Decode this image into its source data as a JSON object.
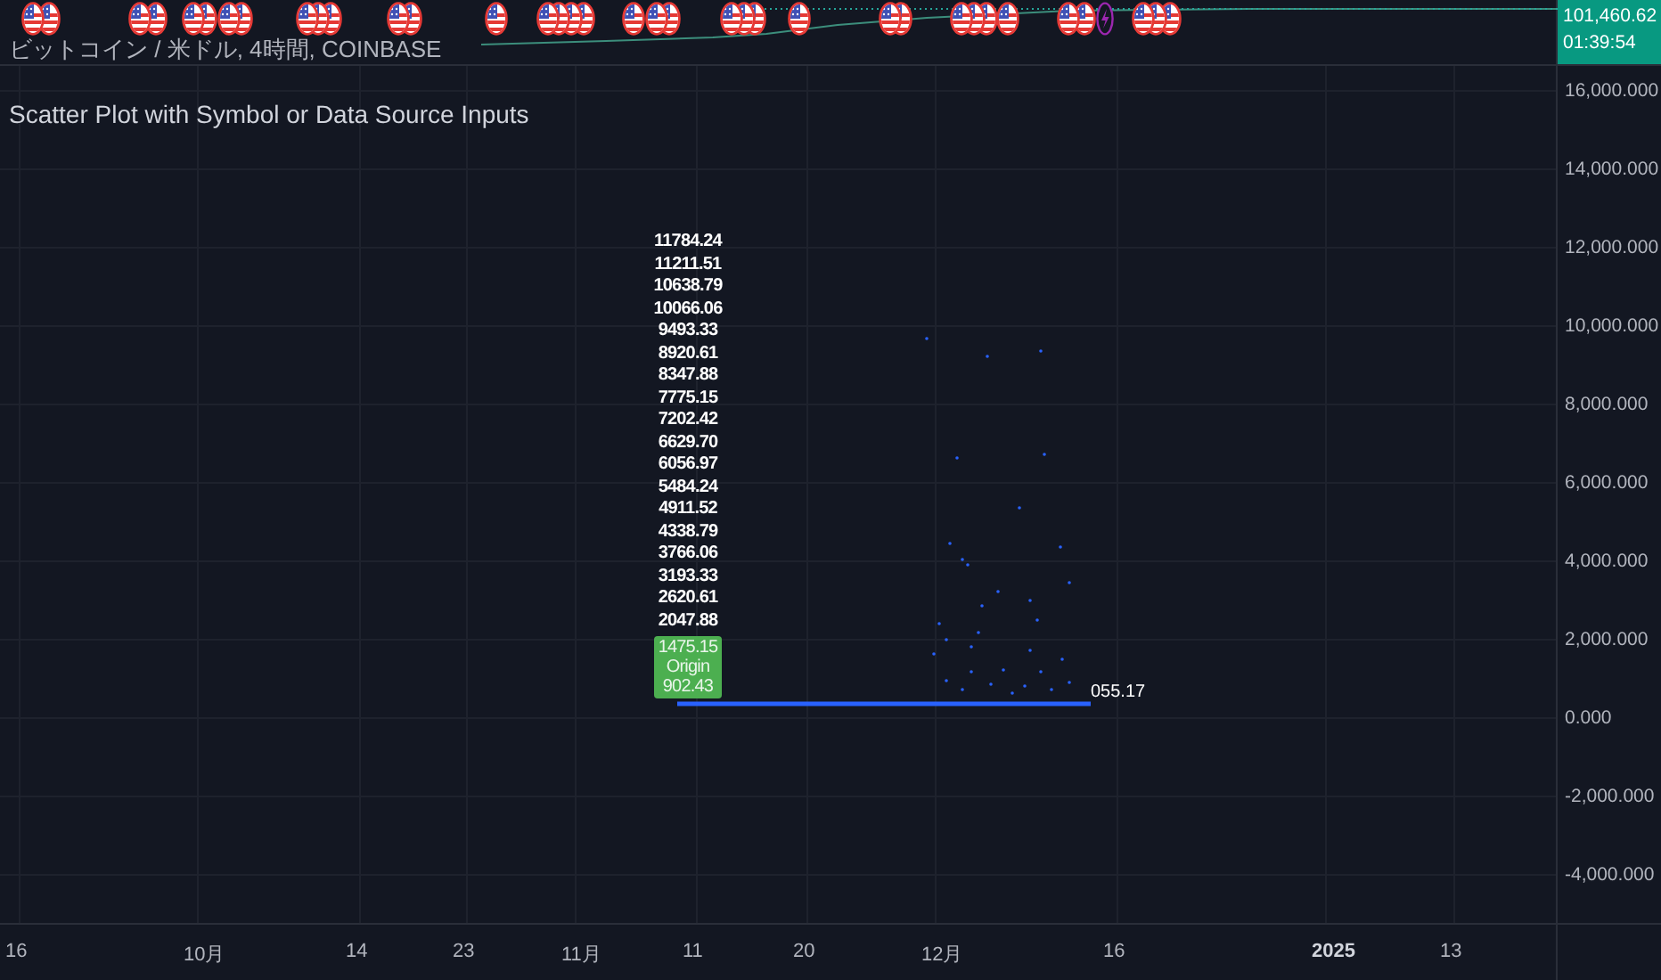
{
  "symbol_title": "ビットコイン / 米ドル, 4時間, COINBASE",
  "price_tag": {
    "price": "101,460.62",
    "countdown": "01:39:54"
  },
  "indicator_title": "Scatter Plot with Symbol or Data Source Inputs",
  "price_axis": [
    "16,000.000",
    "14,000.000",
    "12,000.000",
    "10,000.000",
    "8,000.000",
    "6,000.000",
    "4,000.000",
    "2,000.000",
    "0.000",
    "-2,000.000",
    "-4,000.000"
  ],
  "y_value_labels": [
    "11784.24",
    "11211.51",
    "10638.79",
    "10066.06",
    "9493.33",
    "8920.61",
    "8347.88",
    "7775.15",
    "7202.42",
    "6629.70",
    "6056.97",
    "5484.24",
    "4911.52",
    "4338.79",
    "3766.06",
    "3193.33",
    "2620.61",
    "2047.88"
  ],
  "origin_marker": {
    "label": "Origin",
    "values": [
      "1475.15",
      "902.43"
    ]
  },
  "x_value_labels": [
    "055.17"
  ],
  "time_axis": [
    {
      "label": "16",
      "bold": false
    },
    {
      "label": "10月",
      "bold": false
    },
    {
      "label": "14",
      "bold": false
    },
    {
      "label": "23",
      "bold": false
    },
    {
      "label": "11月",
      "bold": false
    },
    {
      "label": "11",
      "bold": false
    },
    {
      "label": "20",
      "bold": false
    },
    {
      "label": "12月",
      "bold": false
    },
    {
      "label": "16",
      "bold": false
    },
    {
      "label": "2025",
      "bold": true
    },
    {
      "label": "13",
      "bold": false
    }
  ]
}
